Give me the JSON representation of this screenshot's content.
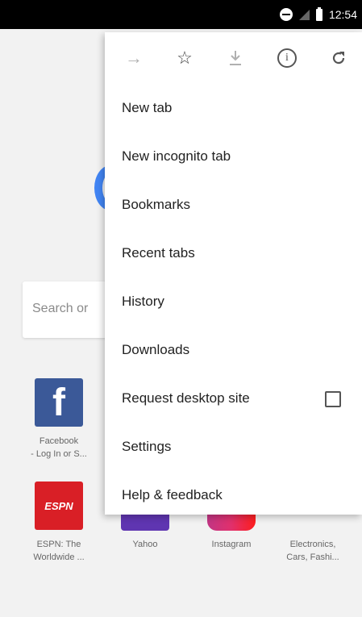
{
  "status_bar": {
    "time": "12:54"
  },
  "search": {
    "placeholder": "Search or"
  },
  "tiles": [
    {
      "name": "facebook",
      "icon_text": "f",
      "label_line1": "Facebook",
      "label_line2": "- Log In or S..."
    },
    {
      "name": "espn",
      "icon_text": "ESPN",
      "label_line1": "ESPN: The",
      "label_line2": "Worldwide ..."
    },
    {
      "name": "yahoo",
      "label_line1": "Yahoo"
    },
    {
      "name": "instagram",
      "label_line1": "Instagram"
    },
    {
      "name": "electronics",
      "label_line1": "Electronics,",
      "label_line2": "Cars, Fashi..."
    }
  ],
  "menu": {
    "toolbar_icons": [
      "forward-icon",
      "bookmark-star-icon",
      "download-icon",
      "info-icon",
      "reload-icon"
    ],
    "items": [
      {
        "label": "New tab"
      },
      {
        "label": "New incognito tab"
      },
      {
        "label": "Bookmarks"
      },
      {
        "label": "Recent tabs"
      },
      {
        "label": "History"
      },
      {
        "label": "Downloads"
      },
      {
        "label": "Request desktop site",
        "checked": false
      },
      {
        "label": "Settings"
      },
      {
        "label": "Help & feedback"
      }
    ]
  },
  "colors": {
    "accent": "#4285f4",
    "facebook": "#3b5998",
    "espn": "#d91f26"
  }
}
